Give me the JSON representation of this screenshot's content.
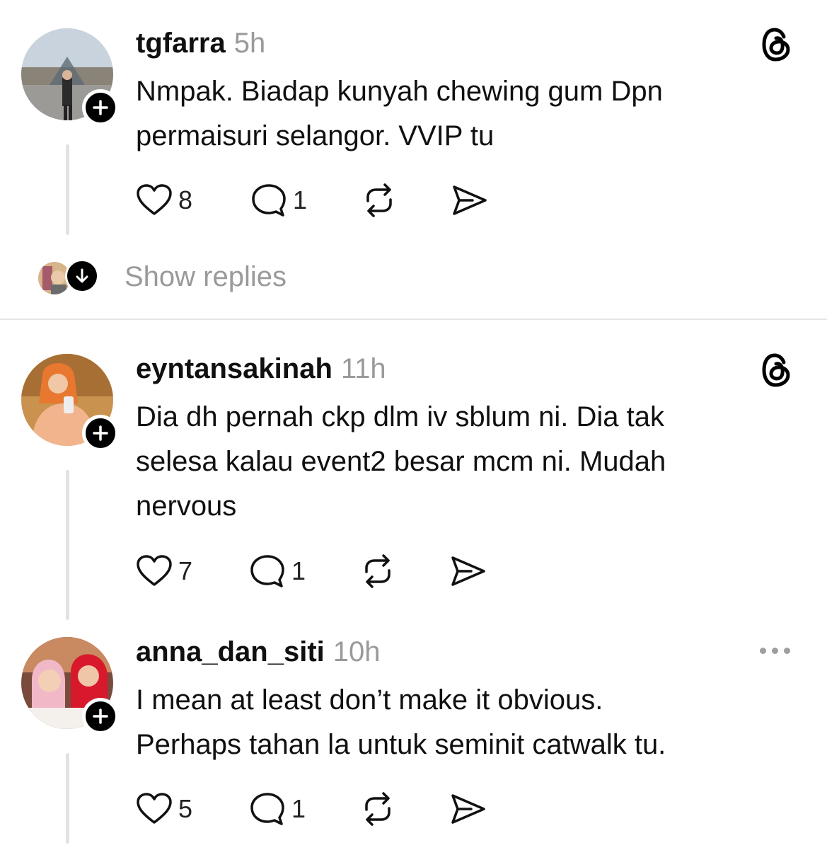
{
  "posts": [
    {
      "username": "tgfarra",
      "time": "5h",
      "text": [
        "Nmpak. Biadap kunyah chewing gum Dpn",
        "permaisuri selangor. VVIP tu"
      ],
      "likes": "8",
      "replies": "1",
      "corner_icon": "threads-logo-icon"
    },
    {
      "username": "eyntansakinah",
      "time": "11h",
      "text": [
        "Dia dh pernah ckp dlm iv sblum ni. Dia tak",
        "selesa kalau event2 besar mcm ni. Mudah",
        "nervous"
      ],
      "likes": "7",
      "replies": "1",
      "corner_icon": "threads-logo-icon"
    },
    {
      "username": "anna_dan_siti",
      "time": "10h",
      "text": [
        "I mean at least don’t make it obvious.",
        "Perhaps tahan la untuk seminit catwalk tu."
      ],
      "likes": "5",
      "replies": "1",
      "corner_icon": "more-options-icon"
    }
  ],
  "show_replies": {
    "label": "Show replies"
  },
  "colors": {
    "text": "#101010",
    "muted": "#9a9a9a",
    "line": "#e2e2e2",
    "accent": "#000000"
  }
}
